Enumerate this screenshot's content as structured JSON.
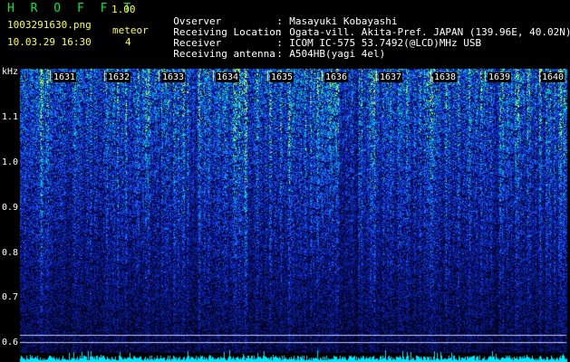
{
  "header": {
    "app_title": "H R O F F T",
    "version": "1.00",
    "filename": "1003291630.png",
    "meteor_label": "meteor",
    "datetime": "10.03.29 16:30",
    "meteor_count": "4"
  },
  "info": [
    {
      "key": "Ovserver",
      "sep": ":",
      "value": "Masayuki Kobayashi"
    },
    {
      "key": "Receiving Location",
      "sep": ":",
      "value": "Ogata-vill. Akita-Pref. JAPAN (139.96E, 40.02N)"
    },
    {
      "key": "Receiver",
      "sep": ":",
      "value": "ICOM IC-575 53.7492(@LCD)MHz USB"
    },
    {
      "key": "Receiving antenna",
      "sep": ":",
      "value": "A504HB(yagi 4el)"
    }
  ],
  "axis": {
    "unit": "kHz",
    "ticks": [
      "1.1",
      "1.0",
      "0.9",
      "0.8",
      "0.7",
      "0.6"
    ]
  },
  "time_labels": [
    "1631",
    "1632",
    "1633",
    "1634",
    "1635",
    "1636",
    "1637",
    "1638",
    "1639",
    "1640"
  ],
  "colors": {
    "background": "#000000",
    "title_green": "#00e64d",
    "header_yellow": "#ffff44",
    "signal_low": "#0a1f6e",
    "signal_mid": "#1e6bff",
    "signal_high": "#00e0c0",
    "signal_peak": "#ffff33",
    "noise_trace": "#00e5ff"
  }
}
